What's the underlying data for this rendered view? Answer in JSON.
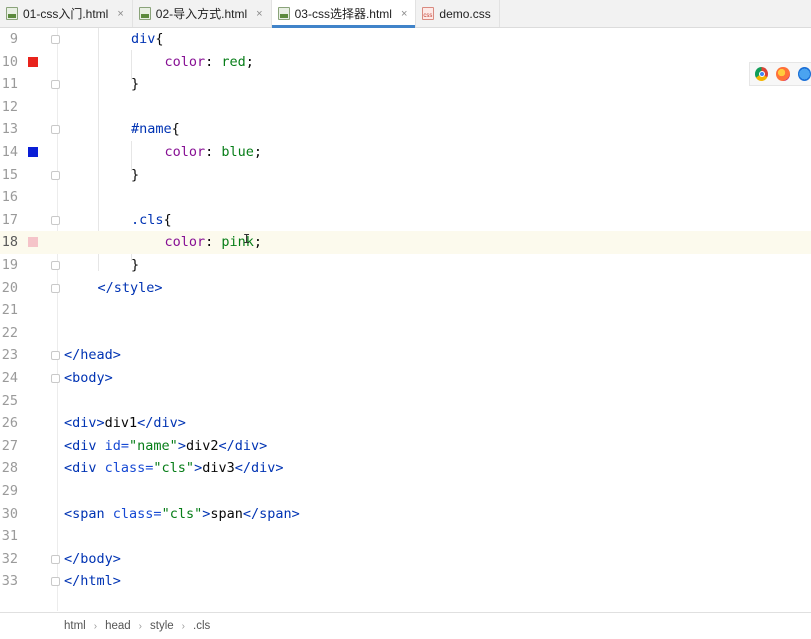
{
  "tabs": [
    {
      "label": "01-css入门.html",
      "type": "html",
      "active": false
    },
    {
      "label": "02-导入方式.html",
      "type": "html",
      "active": false
    },
    {
      "label": "03-css选择器.html",
      "type": "html",
      "active": true
    },
    {
      "label": "demo.css",
      "type": "css",
      "active": false
    }
  ],
  "tab_close_glyph": "×",
  "lines": [
    {
      "n": "9",
      "indent": 2,
      "tokens": [
        [
          "tag",
          "div"
        ],
        [
          "punc",
          "{"
        ]
      ]
    },
    {
      "n": "10",
      "indent": 3,
      "swatch": "#e8231c",
      "tokens": [
        [
          "prop",
          "color"
        ],
        [
          "punc",
          ": "
        ],
        [
          "val",
          "red"
        ],
        [
          "punc",
          ";"
        ]
      ]
    },
    {
      "n": "11",
      "indent": 2,
      "tokens": [
        [
          "punc",
          "}"
        ]
      ]
    },
    {
      "n": "12",
      "indent": 0,
      "tokens": []
    },
    {
      "n": "13",
      "indent": 2,
      "tokens": [
        [
          "tag",
          "#name"
        ],
        [
          "punc",
          "{"
        ]
      ]
    },
    {
      "n": "14",
      "indent": 3,
      "swatch": "#0a1ed6",
      "tokens": [
        [
          "prop",
          "color"
        ],
        [
          "punc",
          ": "
        ],
        [
          "val",
          "blue"
        ],
        [
          "punc",
          ";"
        ]
      ]
    },
    {
      "n": "15",
      "indent": 2,
      "tokens": [
        [
          "punc",
          "}"
        ]
      ]
    },
    {
      "n": "16",
      "indent": 0,
      "tokens": []
    },
    {
      "n": "17",
      "indent": 2,
      "tokens": [
        [
          "tag",
          ".cls"
        ],
        [
          "punc",
          "{"
        ]
      ]
    },
    {
      "n": "18",
      "indent": 3,
      "swatch": "#f5c4c9",
      "current": true,
      "tokens": [
        [
          "prop",
          "color"
        ],
        [
          "punc",
          ": "
        ],
        [
          "val",
          "pink"
        ],
        [
          "punc",
          ";"
        ]
      ]
    },
    {
      "n": "19",
      "indent": 2,
      "tokens": [
        [
          "punc",
          "}"
        ]
      ]
    },
    {
      "n": "20",
      "indent": 1,
      "tokens": [
        [
          "tag",
          "</style>"
        ]
      ]
    },
    {
      "n": "21",
      "indent": 0,
      "tokens": []
    },
    {
      "n": "22",
      "indent": 0,
      "tokens": []
    },
    {
      "n": "23",
      "indent": 0,
      "tokens": [
        [
          "tag",
          "</head>"
        ]
      ]
    },
    {
      "n": "24",
      "indent": 0,
      "tokens": [
        [
          "tag",
          "<body>"
        ]
      ]
    },
    {
      "n": "25",
      "indent": 0,
      "tokens": []
    },
    {
      "n": "26",
      "indent": 0,
      "tokens": [
        [
          "tag",
          "<div>"
        ],
        [
          "plain",
          "div1"
        ],
        [
          "tag",
          "</div>"
        ]
      ]
    },
    {
      "n": "27",
      "indent": 0,
      "tokens": [
        [
          "tag",
          "<div "
        ],
        [
          "attr",
          "id="
        ],
        [
          "str",
          "\"name\""
        ],
        [
          "tag",
          ">"
        ],
        [
          "plain",
          "div2"
        ],
        [
          "tag",
          "</div>"
        ]
      ]
    },
    {
      "n": "28",
      "indent": 0,
      "tokens": [
        [
          "tag",
          "<div "
        ],
        [
          "attr",
          "class="
        ],
        [
          "str",
          "\"cls\""
        ],
        [
          "tag",
          ">"
        ],
        [
          "plain",
          "div3"
        ],
        [
          "tag",
          "</div>"
        ]
      ]
    },
    {
      "n": "29",
      "indent": 0,
      "tokens": []
    },
    {
      "n": "30",
      "indent": 0,
      "tokens": [
        [
          "tag",
          "<span "
        ],
        [
          "attr",
          "class="
        ],
        [
          "str",
          "\"cls\""
        ],
        [
          "tag",
          ">"
        ],
        [
          "plain",
          "span"
        ],
        [
          "tag",
          "</span>"
        ]
      ]
    },
    {
      "n": "31",
      "indent": 0,
      "tokens": []
    },
    {
      "n": "32",
      "indent": 0,
      "tokens": [
        [
          "tag",
          "</body>"
        ]
      ]
    },
    {
      "n": "33",
      "indent": 0,
      "tokens": [
        [
          "tag",
          "</html>"
        ]
      ]
    }
  ],
  "browser_icons": [
    "chrome-icon",
    "firefox-icon",
    "safari-icon"
  ],
  "breadcrumb": [
    "html",
    "head",
    "style",
    ".cls"
  ],
  "breadcrumb_sep": "›",
  "cursor_glyph": "I",
  "colors": {
    "accent": "#4083c9",
    "tag": "#0033b3",
    "string": "#067d17",
    "property": "#871094",
    "current_line": "#fcfaed"
  }
}
